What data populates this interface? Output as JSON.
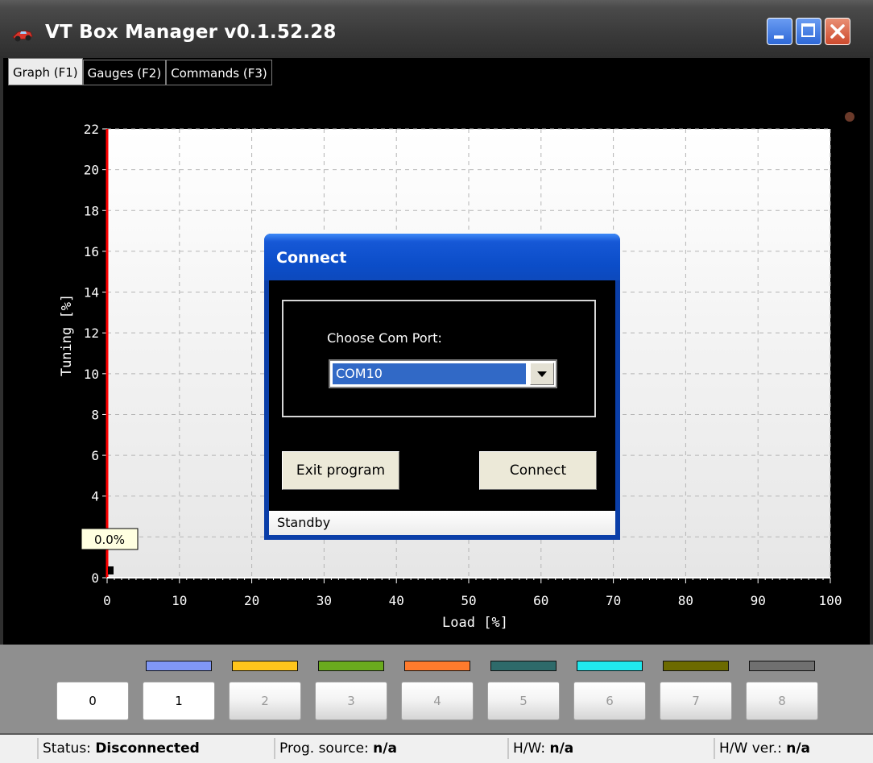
{
  "window": {
    "title": "VT Box Manager v0.1.52.28",
    "icon": "racing-car-icon",
    "controls": [
      "minimize-icon",
      "maximize-icon",
      "close-icon"
    ]
  },
  "tabs": [
    {
      "label": "Graph (F1)",
      "active": true
    },
    {
      "label": "Gauges (F2)",
      "active": false
    },
    {
      "label": "Commands (F3)",
      "active": false
    }
  ],
  "graph": {
    "xlabel": "Load [%]",
    "ylabel": "Tuning [%]",
    "x_ticks": [
      "0",
      "10",
      "20",
      "30",
      "40",
      "50",
      "60",
      "70",
      "80",
      "90",
      "100"
    ],
    "y_ticks": [
      "0",
      "2",
      "4",
      "6",
      "8",
      "10",
      "12",
      "14",
      "16",
      "18",
      "20",
      "22"
    ],
    "xlim": [
      0,
      100
    ],
    "ylim": [
      0,
      22
    ],
    "cursor_label": "0.0%",
    "grid": true,
    "colors": {
      "axis_highlight": "#ff0000",
      "indicator": "#6b3a2a"
    }
  },
  "dialog": {
    "title": "Connect",
    "com_label": "Choose Com Port:",
    "com_value": "COM10",
    "exit_label": "Exit program",
    "connect_label": "Connect",
    "status": "Standby"
  },
  "channels": [
    {
      "label": "0",
      "color": null,
      "enabled": true
    },
    {
      "label": "1",
      "color": "#8097f5",
      "enabled": true
    },
    {
      "label": "2",
      "color": "#ffc51c",
      "enabled": false
    },
    {
      "label": "3",
      "color": "#6aaa1e",
      "enabled": false
    },
    {
      "label": "4",
      "color": "#ff7b2d",
      "enabled": false
    },
    {
      "label": "5",
      "color": "#2e6a6a",
      "enabled": false
    },
    {
      "label": "6",
      "color": "#21e8ee",
      "enabled": false
    },
    {
      "label": "7",
      "color": "#6c6a00",
      "enabled": false
    },
    {
      "label": "8",
      "color": "#707070",
      "enabled": false
    }
  ],
  "statusbar": {
    "status_label": "Status:",
    "status_value": "Disconnected",
    "prog_label": "Prog. source:",
    "prog_value": "n/a",
    "hw_label": "H/W:",
    "hw_value": "n/a",
    "hwver_label": "H/W ver.:",
    "hwver_value": "n/a"
  }
}
